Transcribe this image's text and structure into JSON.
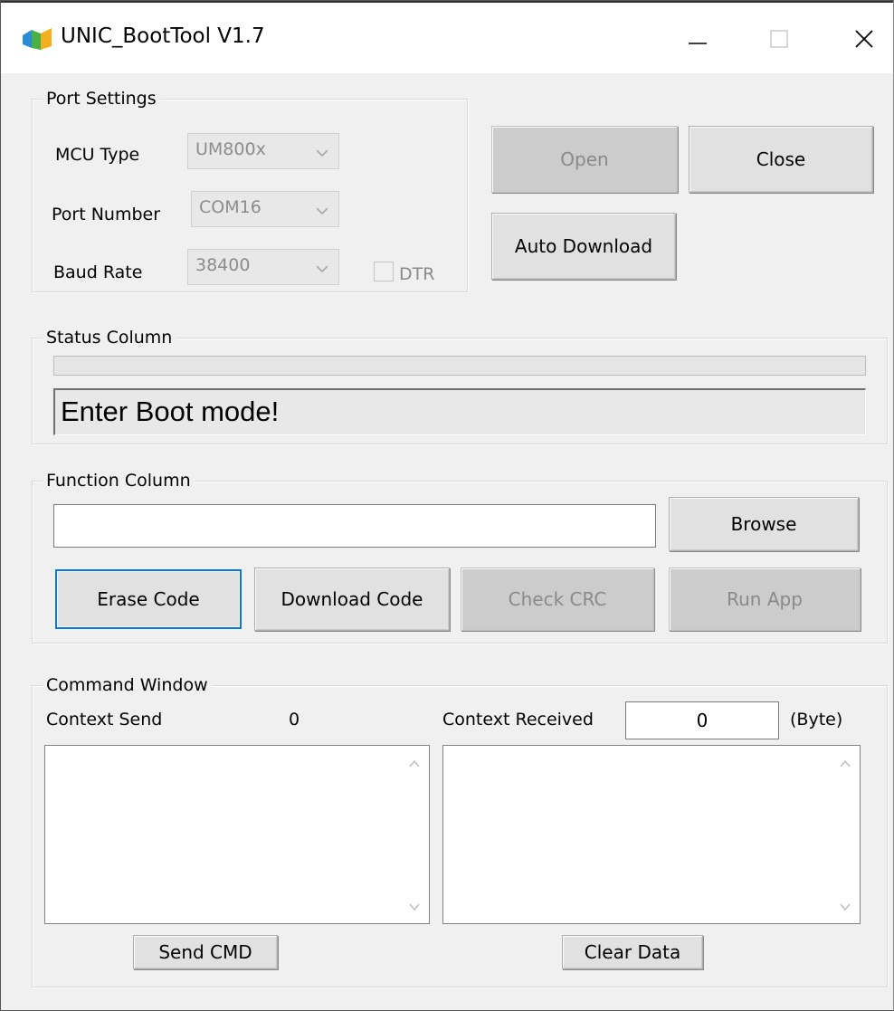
{
  "window": {
    "title": "UNIC_BootTool V1.7",
    "icon": "app-icon",
    "controls": {
      "minimize": "minimize-icon",
      "maximize": "maximize-icon",
      "close": "close-icon"
    }
  },
  "port_settings": {
    "legend": "Port Settings",
    "mcu_type_label": "MCU Type",
    "mcu_type_value": "UM800x",
    "port_number_label": "Port Number",
    "port_number_value": "COM16",
    "baud_rate_label": "Baud Rate",
    "baud_rate_value": "38400",
    "dtr_label": "DTR"
  },
  "actions": {
    "open_label": "Open",
    "close_label": "Close",
    "auto_download_label": "Auto Download"
  },
  "status": {
    "legend": "Status Column",
    "progress_percent": 0,
    "message": "Enter Boot mode!"
  },
  "function": {
    "legend": "Function Column",
    "file_path": "",
    "browse_label": "Browse",
    "erase_label": "Erase Code",
    "download_label": "Download Code",
    "check_crc_label": "Check CRC",
    "run_app_label": "Run App"
  },
  "command": {
    "legend": "Command Window",
    "send_label": "Context Send",
    "send_count": "0",
    "received_label": "Context Received",
    "received_count": "0",
    "unit_label": "(Byte)",
    "send_cmd_label": "Send CMD",
    "clear_data_label": "Clear Data"
  },
  "colors": {
    "accent": "#0078d7",
    "window_bg": "#f0f0f0",
    "disabled_text": "#8a8a8a"
  }
}
